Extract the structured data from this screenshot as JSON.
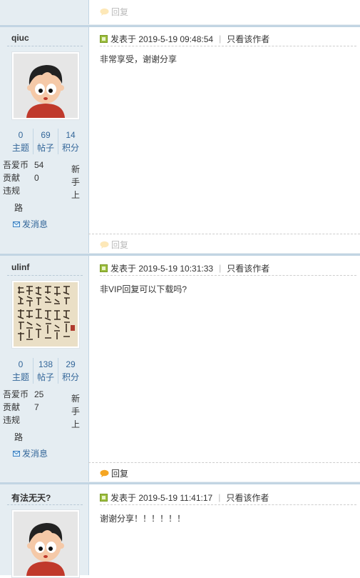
{
  "top_fragment": {
    "reply_label": "回复"
  },
  "posts": [
    {
      "username": "qiuc",
      "avatar": "cartoon-boy-avatar",
      "stats": [
        {
          "num": "0",
          "label": "主题"
        },
        {
          "num": "69",
          "label": "帖子"
        },
        {
          "num": "14",
          "label": "积分"
        }
      ],
      "info": [
        {
          "key": "吾爱币",
          "value": "54"
        },
        {
          "key": "贡献",
          "value": "0"
        },
        {
          "key": "违规",
          "value": ""
        }
      ],
      "rank": [
        "新",
        "手",
        "上"
      ],
      "road": "路",
      "message_label": "发消息",
      "posted_at": "发表于 2019-5-19 09:48:54",
      "author_only": "只看该作者",
      "body": "非常享受，谢谢分享",
      "reply_label": "回复"
    },
    {
      "username": "ulinf",
      "avatar": "calligraphy-avatar",
      "stats": [
        {
          "num": "0",
          "label": "主题"
        },
        {
          "num": "138",
          "label": "帖子"
        },
        {
          "num": "29",
          "label": "积分"
        }
      ],
      "info": [
        {
          "key": "吾爱币",
          "value": "25"
        },
        {
          "key": "贡献",
          "value": "7"
        },
        {
          "key": "违规",
          "value": ""
        }
      ],
      "rank": [
        "新",
        "手",
        "上"
      ],
      "road": "路",
      "message_label": "发消息",
      "posted_at": "发表于 2019-5-19 10:31:33",
      "author_only": "只看该作者",
      "body": "非VIP回复可以下载吗?",
      "reply_label": "回复"
    },
    {
      "username": "有法无天?",
      "avatar": "cartoon-boy-avatar",
      "posted_at": "发表于 2019-5-19 11:41:17",
      "author_only": "只看该作者",
      "body": "谢谢分享！！！！！！"
    }
  ],
  "colors": {
    "sidebar_bg": "#e5edf2",
    "separator": "#c2d5e3",
    "link_blue": "#336699",
    "post_icon_green": "#9bbd3c",
    "reply_icon_orange": "#f5a623"
  }
}
